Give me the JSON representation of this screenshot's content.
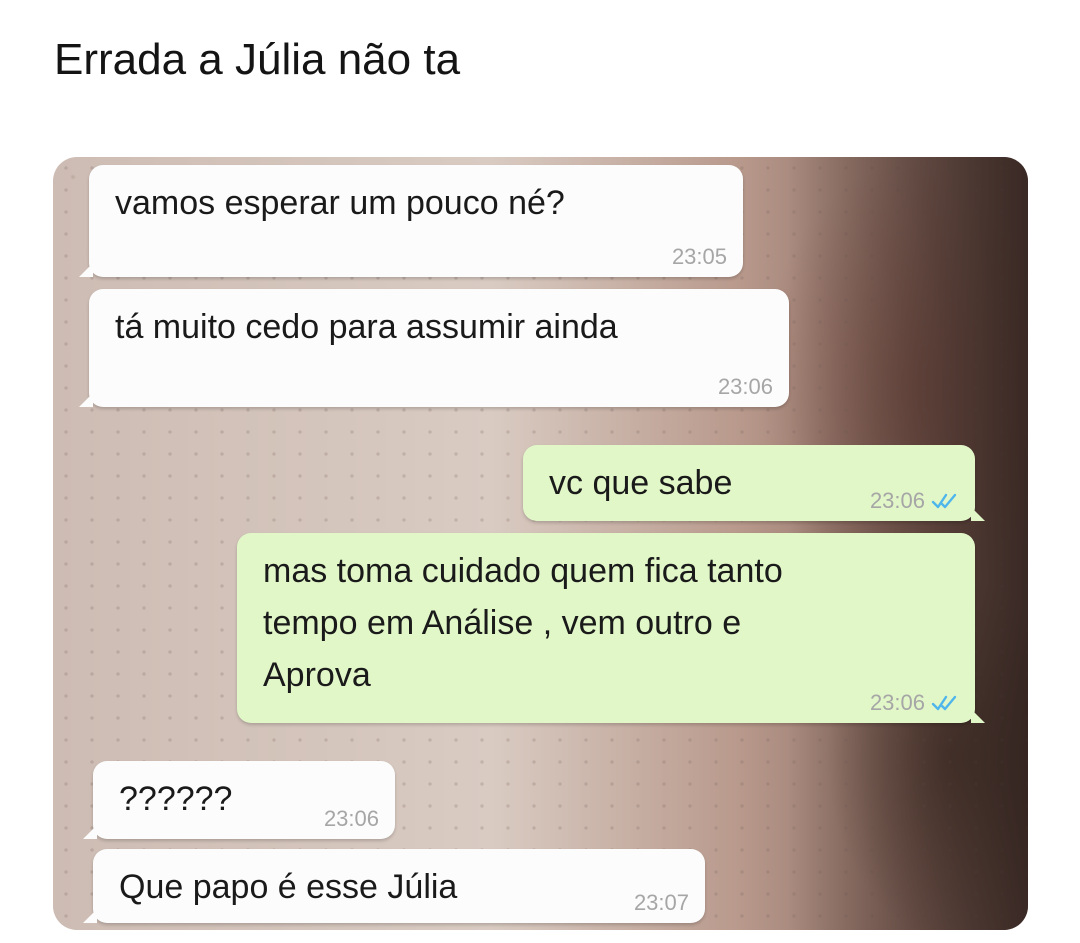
{
  "post": {
    "caption": "Errada a Júlia não ta"
  },
  "chat": {
    "messages": [
      {
        "direction": "incoming",
        "text": "vamos esperar um pouco né?",
        "time": "23:05"
      },
      {
        "direction": "incoming",
        "text": "tá muito cedo para assumir ainda",
        "time": "23:06"
      },
      {
        "direction": "outgoing",
        "text": "vc que sabe",
        "time": "23:06",
        "status_icon": "double-check-icon"
      },
      {
        "direction": "outgoing",
        "text": "mas toma cuidado quem fica tanto\ntempo em Análise , vem outro e\nAprova",
        "time": "23:06",
        "status_icon": "double-check-icon"
      },
      {
        "direction": "incoming",
        "text": "??????",
        "time": "23:06"
      },
      {
        "direction": "incoming",
        "text": "Que papo é esse Júlia",
        "time": "23:07"
      }
    ]
  },
  "colors": {
    "incoming_bubble": "#fcfcfc",
    "outgoing_bubble": "#e1f7c8",
    "read_tick": "#4fb6ec",
    "timestamp": "#a6a6a6"
  }
}
